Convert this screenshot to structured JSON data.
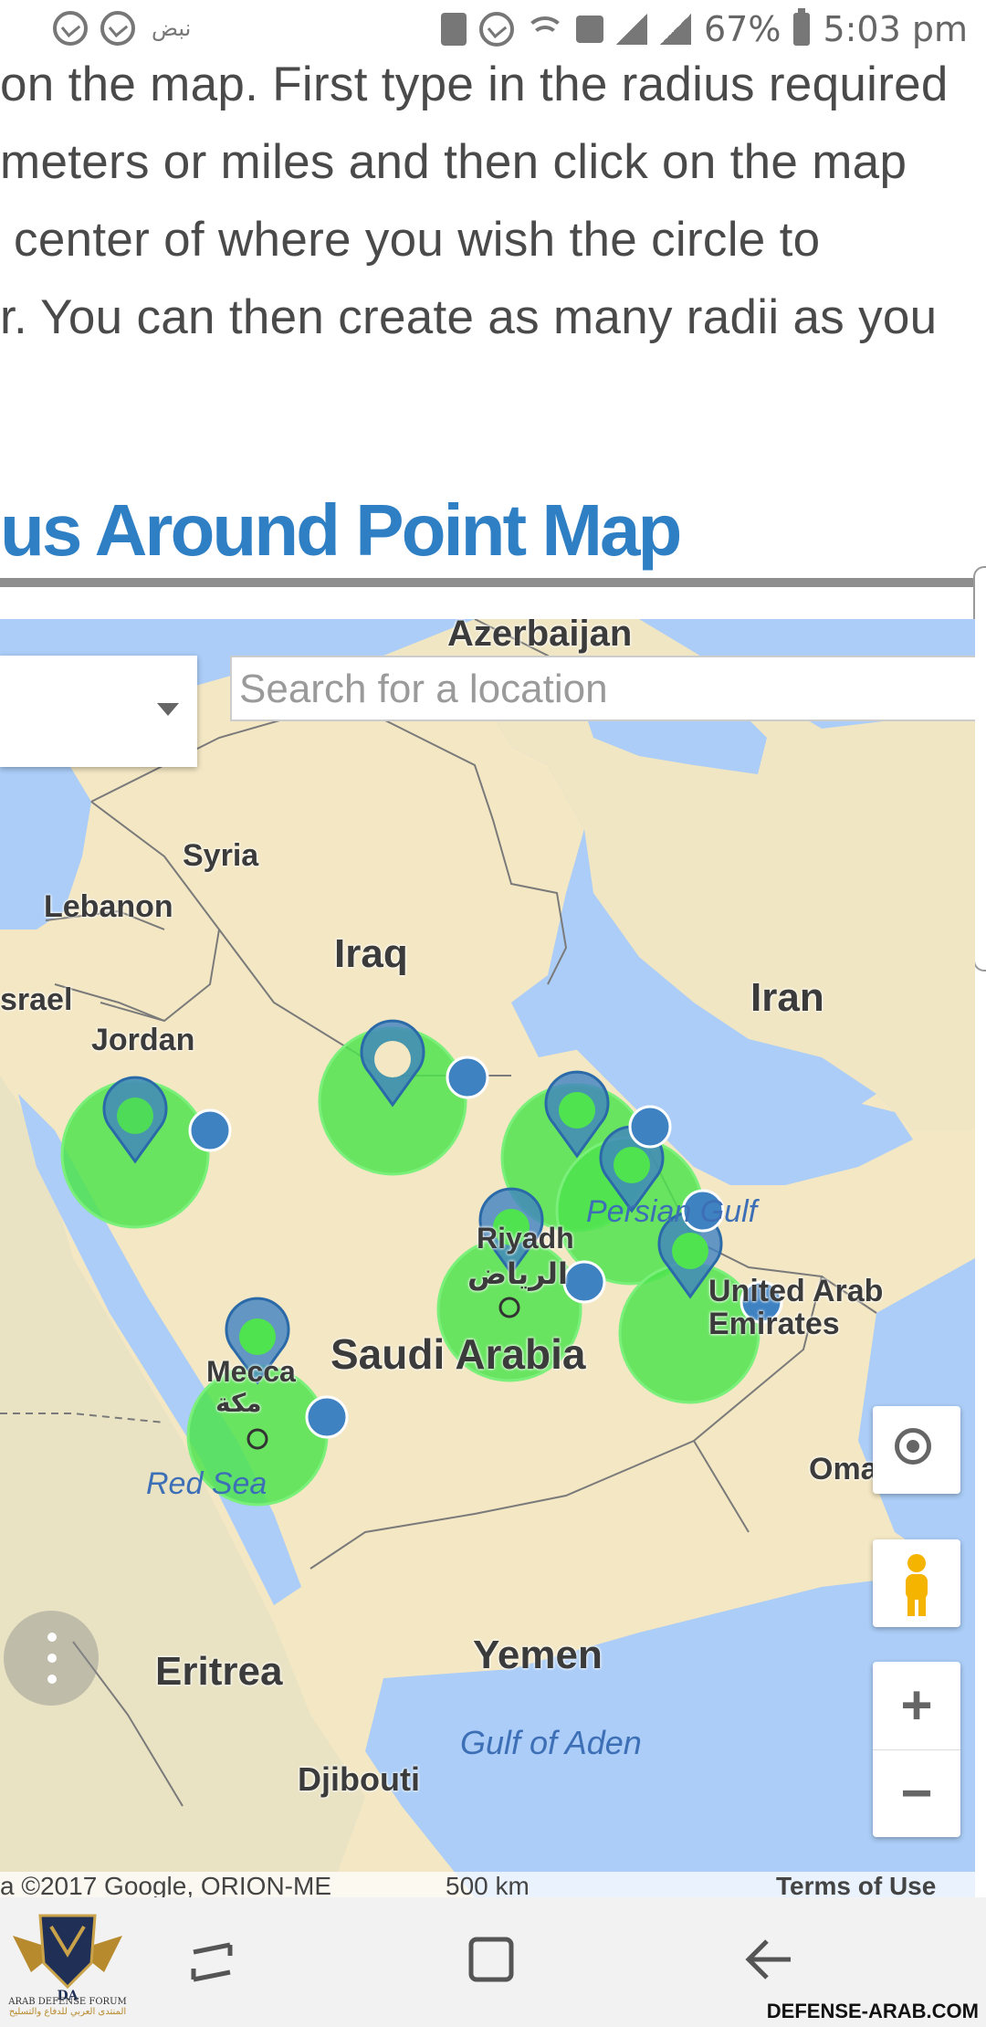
{
  "status_bar": {
    "arabic_label": "نبض",
    "battery": "67%",
    "time": "5:03 pm"
  },
  "article": {
    "lines": [
      "on the map. First type in the radius required",
      "meters or miles and then click on the map",
      " center of where you wish the circle to",
      "r. You can then create as many radii as you"
    ],
    "heading": "us Around Point Map"
  },
  "map": {
    "search_placeholder": "Search for a location",
    "labels": {
      "azerbaijan": "Azerbaijan",
      "syria": "Syria",
      "lebanon": "Lebanon",
      "israel": "srael",
      "jordan": "Jordan",
      "iraq": "Iraq",
      "iran": "Iran",
      "riyadh": "Riyadh",
      "riyadh_ar": "الرياض",
      "saudi_arabia": "Saudi Arabia",
      "mecca": "Mecca",
      "mecca_ar": "مكة",
      "uae": "United Arab Emirates",
      "oman": "Oma",
      "eritrea": "Eritrea",
      "yemen": "Yemen",
      "djibouti": "Djibouti"
    },
    "water_labels": {
      "persian_gulf": "Persian Gulf",
      "red_sea": "Red Sea",
      "gulf_of_aden": "Gulf of Aden"
    },
    "footer": {
      "copyright": "a ©2017 Google, ORION-ME",
      "scale": "500 km",
      "terms": "Terms of Use"
    },
    "zoom_in": "+",
    "zoom_out": "−"
  },
  "logo": {
    "letters": "DA",
    "caption": "ARAB DEFENSE FORUM",
    "caption_ar": "المنتدى العربي للدفاع والتسليح"
  },
  "watermark": "DEFENSE-ARAB.COM",
  "colors": {
    "heading": "#2f7fc4",
    "land": "#f3e7c4",
    "water": "#abcdf7",
    "radius_fill": "#4fe34f",
    "marker": "#3f82c2"
  }
}
